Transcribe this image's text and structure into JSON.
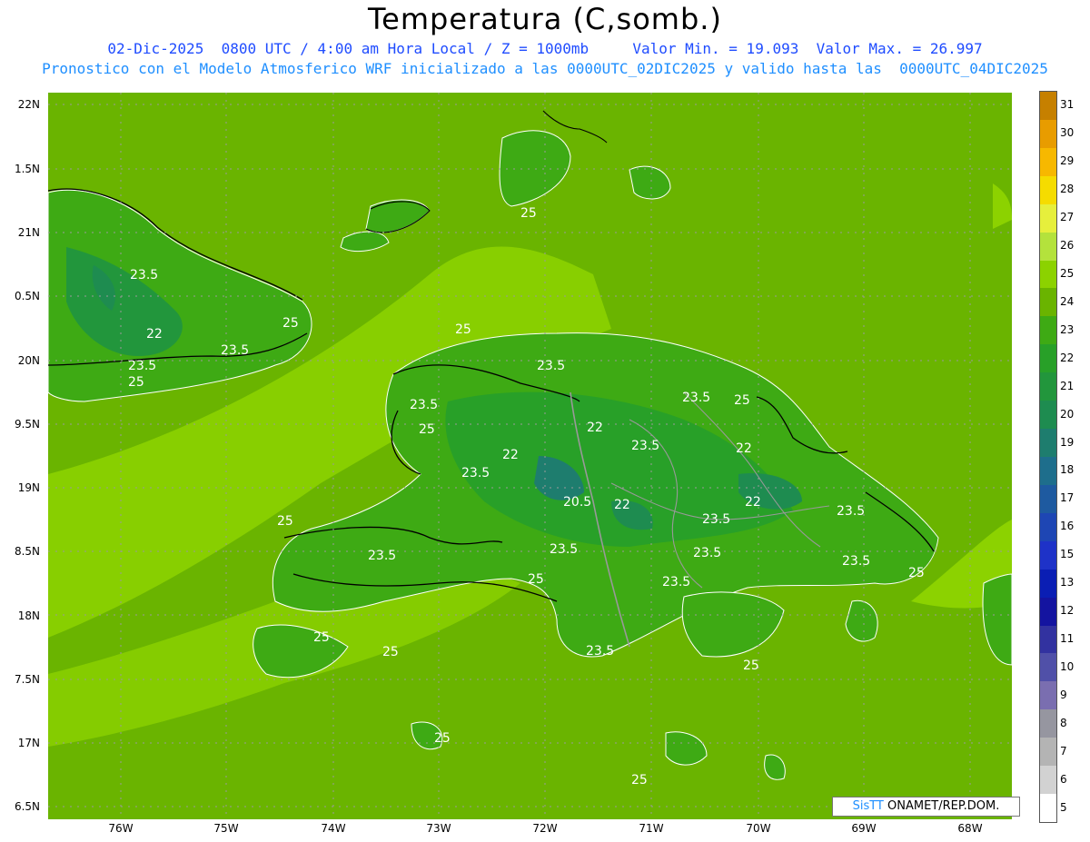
{
  "title": "Temperatura (C,somb.)",
  "subtitle1": "02-Dic-2025  0800 UTC / 4:00 am Hora Local / Z = 1000mb     Valor Min. = 19.093  Valor Max. = 26.997",
  "subtitle2": "Pronostico con el Modelo Atmosferico WRF inicializado a las 0000UTC_02DIC2025 y valido hasta las  0000UTC_04DIC2025",
  "lat_labels": [
    "22N",
    "1.5N",
    "21N",
    "0.5N",
    "20N",
    "9.5N",
    "19N",
    "8.5N",
    "18N",
    "7.5N",
    "17N",
    "6.5N"
  ],
  "lon_labels": [
    "76W",
    "75W",
    "74W",
    "73W",
    "72W",
    "71W",
    "70W",
    "69W",
    "68W"
  ],
  "colorbar": {
    "labels": [
      "31",
      "30",
      "29",
      "28",
      "27",
      "26",
      "25",
      "24",
      "23",
      "22",
      "21",
      "20",
      "19",
      "18",
      "17",
      "16",
      "15",
      "13",
      "12",
      "11",
      "10",
      "9",
      "8",
      "7",
      "6",
      "5"
    ],
    "colors": [
      "#c68000",
      "#e89c00",
      "#f7b800",
      "#f5dc00",
      "#e6ef3c",
      "#b4e23c",
      "#8cd200",
      "#6ab400",
      "#3eaa14",
      "#28a028",
      "#22963c",
      "#1e8c50",
      "#1e7d6e",
      "#1e6e8c",
      "#1e5aa0",
      "#1e46b4",
      "#1e32c8",
      "#0a1eb4",
      "#1414a0",
      "#3232a0",
      "#5050a8",
      "#7a6eb0",
      "#9696a0",
      "#b4b4b4",
      "#d2d2d2",
      "#ffffff"
    ]
  },
  "contour_labels": [
    "25",
    "23.5",
    "22",
    "20.5"
  ],
  "credit": {
    "sis": "SisTT",
    "rest": " ONAMET/REP.DOM."
  },
  "colors": {
    "ocean_warm": "#8cd200",
    "ocean": "#6ab400",
    "land": "#3eaa14",
    "land_cool": "#22963c",
    "interior": "#1e7d6e"
  }
}
